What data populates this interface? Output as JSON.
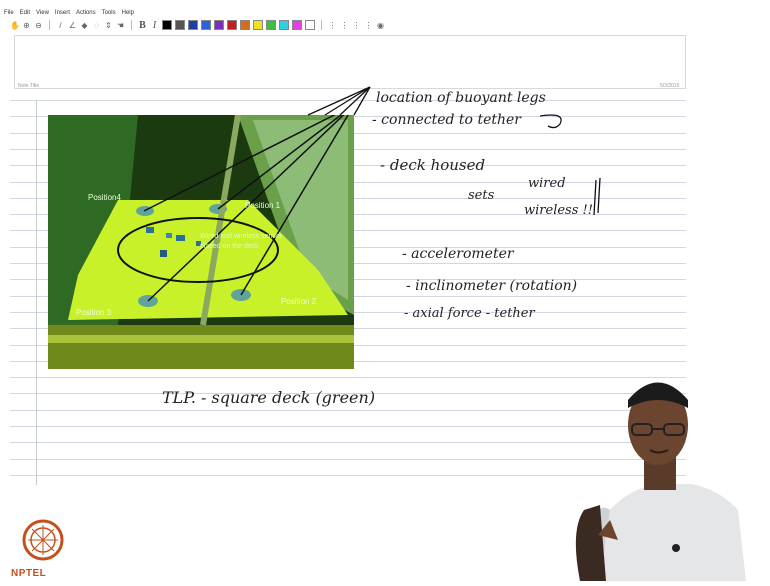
{
  "menu": [
    "File",
    "Edit",
    "View",
    "Insert",
    "Actions",
    "Tools",
    "Help"
  ],
  "note": {
    "title": "Note Title",
    "page": "5/3/2015"
  },
  "photo": {
    "positions": [
      "Position4",
      "Position 1",
      "Position 3",
      "Position 2"
    ],
    "caption": [
      "Wired and wireless sensor",
      "placed on the deck"
    ]
  },
  "handwriting": {
    "l1": "location of buoyant legs",
    "l2": "- connected to tether",
    "l3": "- deck housed",
    "l4": "sets",
    "l5": "wired",
    "l6": "wireless !!",
    "l7": "- accelerometer",
    "l8": "- inclinometer (rotation)",
    "l9": "- axial force - tether",
    "l10": "TLP. - square deck (green)"
  },
  "logo": {
    "text": "NPTEL"
  },
  "colors": {
    "deck": "#c9f12a",
    "tank": "#1c3a10",
    "rule_line": "#cfd6e4",
    "logo": "#c4501b",
    "swatches": [
      "#000000",
      "#555555",
      "#1f3fa6",
      "#2b62d8",
      "#7a2fb8",
      "#c02020",
      "#d86a1a",
      "#f0e020",
      "#3cc040",
      "#30d0e0",
      "#e040e0",
      "#ffffff"
    ]
  }
}
